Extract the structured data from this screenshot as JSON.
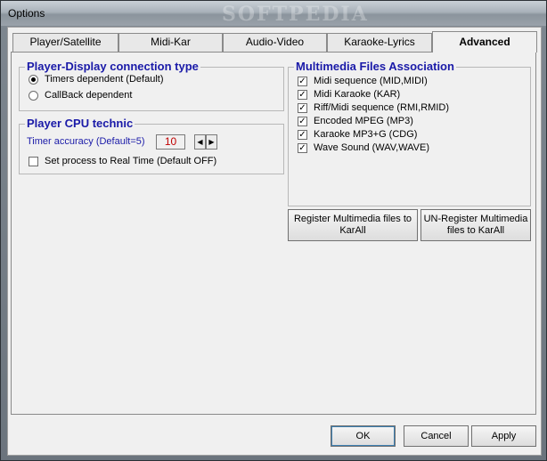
{
  "window": {
    "title": "Options"
  },
  "watermark": "SOFTPEDIA",
  "tabs": [
    {
      "label": "Player/Satellite"
    },
    {
      "label": "Midi-Kar"
    },
    {
      "label": "Audio-Video"
    },
    {
      "label": "Karaoke-Lyrics"
    },
    {
      "label": "Advanced"
    }
  ],
  "player_display": {
    "title": "Player-Display connection type",
    "options": [
      {
        "label": "Timers dependent (Default)"
      },
      {
        "label": "CallBack dependent"
      }
    ],
    "selected": "Timers dependent (Default)"
  },
  "cpu": {
    "title": "Player CPU technic",
    "timer_label": "Timer accuracy (Default=5)",
    "timer_value": "10",
    "realtime_label": "Set process to Real Time (Default OFF)"
  },
  "multimedia": {
    "title": "Multimedia Files Association",
    "items": [
      {
        "label": "Midi sequence  (MID,MIDI)"
      },
      {
        "label": "Midi Karaoke  (KAR)"
      },
      {
        "label": "Riff/Midi sequence  (RMI,RMID)"
      },
      {
        "label": "Encoded MPEG  (MP3)"
      },
      {
        "label": "Karaoke MP3+G  (CDG)"
      },
      {
        "label": "Wave Sound  (WAV,WAVE)"
      }
    ]
  },
  "buttons": {
    "register": "Register Multimedia files to KarAll",
    "unregister": "UN-Register Multimedia files to KarAll",
    "ok": "OK",
    "cancel": "Cancel",
    "apply": "Apply"
  },
  "colors": {
    "group_title": "#1a1aa8",
    "timer_value": "#c00000"
  }
}
